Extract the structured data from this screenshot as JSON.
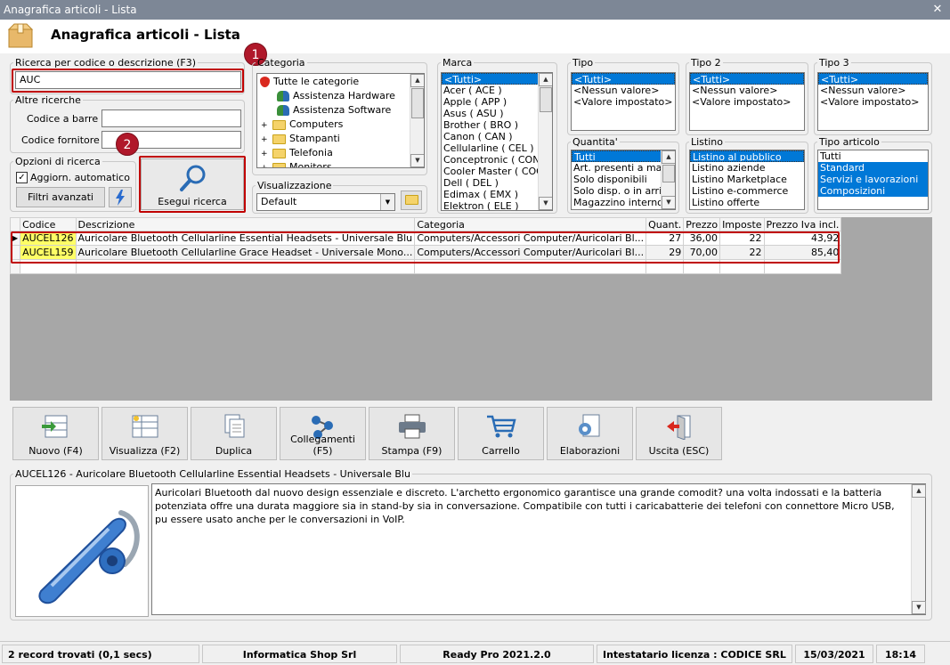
{
  "window": {
    "title": "Anagrafica articoli  - Lista",
    "header_title": "Anagrafica articoli  - Lista"
  },
  "search": {
    "legend": "Ricerca per codice o descrizione (F3)",
    "value": "AUC",
    "altre_legend": "Altre ricerche",
    "barcode_label": "Codice a barre :",
    "supplier_label": "Codice fornitore :",
    "options_legend": "Opzioni di ricerca",
    "auto_update_label": "Aggiorn. automatico",
    "advanced_filters_label": "Filtri avanzati",
    "run_search_label": "Esegui ricerca"
  },
  "badges": {
    "one": "1",
    "two": "2"
  },
  "category": {
    "legend": "Categoria",
    "items": [
      "Tutte le categorie",
      "Assistenza Hardware",
      "Assistenza Software",
      "Computers",
      "Stampanti",
      "Telefonia",
      "Monitors"
    ]
  },
  "view": {
    "legend": "Visualizzazione",
    "value": "Default"
  },
  "brand": {
    "legend": "Marca",
    "items": [
      "<Tutti>",
      "Acer ( ACE )",
      "Apple ( APP )",
      "Asus ( ASU )",
      "Brother ( BRO )",
      "Canon ( CAN )",
      "Cellularline ( CEL )",
      "Conceptronic ( CON )",
      "Cooler Master ( COO )",
      "Dell ( DEL )",
      "Edimax ( EMX )",
      "Elektron ( ELE )"
    ]
  },
  "tipo": {
    "legend": "Tipo",
    "items": [
      "<Tutti>",
      "<Nessun valore>",
      "<Valore impostato>"
    ]
  },
  "tipo2": {
    "legend": "Tipo 2",
    "items": [
      "<Tutti>",
      "<Nessun valore>",
      "<Valore impostato>"
    ]
  },
  "tipo3": {
    "legend": "Tipo 3",
    "items": [
      "<Tutti>",
      "<Nessun valore>",
      "<Valore impostato>"
    ]
  },
  "quantita": {
    "legend": "Quantita'",
    "items": [
      "Tutti",
      "Art. presenti a magazzino",
      "Solo disponibili",
      "Solo disp. o in arrivo",
      "Magazzino interno"
    ]
  },
  "listino": {
    "legend": "Listino",
    "items": [
      "Listino al pubblico",
      "Listino aziende",
      "Listino Marketplace",
      "Listino e-commerce",
      "Listino offerte"
    ]
  },
  "tipo_articolo": {
    "legend": "Tipo articolo",
    "items": [
      "Tutti",
      "Standard",
      "Servizi e lavorazioni",
      "Composizioni"
    ]
  },
  "grid": {
    "columns": [
      "Codice",
      "Descrizione",
      "Categoria",
      "Quant.",
      "Prezzo",
      "Imposte",
      "Prezzo Iva incl."
    ],
    "rows": [
      [
        "AUCEL126",
        "Auricolare Bluetooth Cellularline Essential Headsets - Universale Blu",
        "Computers/Accessori Computer/Auricolari Bl...",
        "27",
        "36,00",
        "22",
        "43,92"
      ],
      [
        "AUCEL159",
        "Auricolare Bluetooth Cellularline Grace Headset - Universale Mono...",
        "Computers/Accessori Computer/Auricolari Bl...",
        "29",
        "70,00",
        "22",
        "85,40"
      ]
    ]
  },
  "toolbar": [
    "Nuovo (F4)",
    "Visualizza (F2)",
    "Duplica",
    "Collegamenti (F5)",
    "Stampa (F9)",
    "Carrello",
    "Elaborazioni",
    "Uscita (ESC)"
  ],
  "detail": {
    "legend": "AUCEL126 - Auricolare Bluetooth Cellularline Essential Headsets - Universale Blu",
    "text": "Auricolari Bluetooth dal nuovo design essenziale e discreto. L'archetto ergonomico garantisce una grande comodit? una volta indossati e la batteria potenziata offre una durata maggiore sia in stand-by sia in conversazione. Compatibile con tutti i caricabatterie dei telefoni con connettore Micro USB, pu essere usato anche per le conversazioni in VoIP."
  },
  "status": {
    "records": "2 record trovati (0,1 secs)",
    "company": "Informatica Shop Srl",
    "version": "Ready Pro 2021.2.0",
    "license": "Intestatario licenza : CODICE SRL",
    "date": "15/03/2021",
    "time": "18:14"
  },
  "colors": {
    "selection": "#0078d7",
    "highlight": "#ffff66",
    "annotation": "#c00000"
  }
}
